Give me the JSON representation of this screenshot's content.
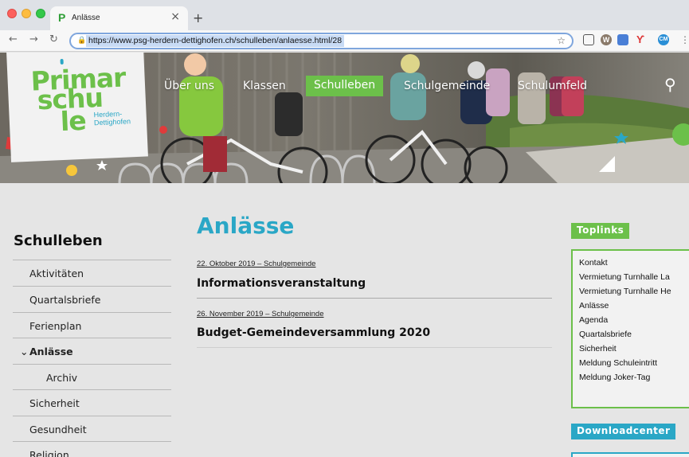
{
  "browser": {
    "tab_title": "Anlässe",
    "tab_favicon": "P",
    "tab_close": "×",
    "new_tab": "+",
    "url": "https://www.psg-herdern-dettighofen.ch/schulleben/anlaesse.html/28",
    "extensions": [
      "W",
      "CM"
    ]
  },
  "logo": {
    "line1": "Primar",
    "line2": "schu",
    "line3": "le",
    "town_line1": "Herdern-",
    "town_line2": "Dettighofen"
  },
  "nav": {
    "items": [
      "Über uns",
      "Klassen",
      "Schulleben",
      "Schulgemeinde",
      "Schulumfeld"
    ],
    "active": "Schulleben"
  },
  "sidebar": {
    "title": "Schulleben",
    "items": [
      {
        "label": "Aktivitäten"
      },
      {
        "label": "Quartalsbriefe"
      },
      {
        "label": "Ferienplan"
      },
      {
        "label": "Anlässe",
        "expanded": true
      },
      {
        "label": "Archiv"
      },
      {
        "label": "Sicherheit"
      },
      {
        "label": "Gesundheit"
      },
      {
        "label": "Religion"
      }
    ]
  },
  "main": {
    "title": "Anlässe",
    "events": [
      {
        "meta": "22. Oktober 2019 – Schulgemeinde",
        "title": "Informationsveranstaltung"
      },
      {
        "meta": "26. November 2019 – Schulgemeinde",
        "title": "Budget-Gemeindeversammlung 2020"
      }
    ]
  },
  "right": {
    "toplinks_title": "Toplinks",
    "toplinks": [
      "Kontakt",
      "Vermietung Turnhalle La",
      "Vermietung Turnhalle He",
      "Anlässe",
      "Agenda",
      "Quartalsbriefe",
      "Sicherheit",
      "Meldung Schuleintritt",
      "Meldung Joker-Tag"
    ],
    "downloads_title": "Downloadcenter"
  },
  "colors": {
    "brand_green": "#6cc04a",
    "brand_blue": "#2aa7c6",
    "page_bg": "#e5e5e5"
  }
}
